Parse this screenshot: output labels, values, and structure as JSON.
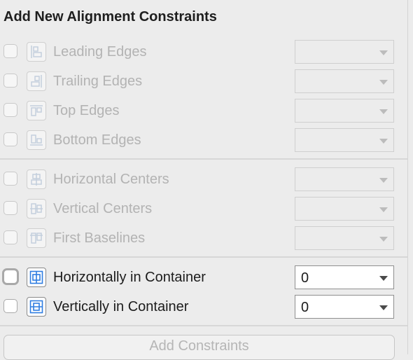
{
  "panel": {
    "title": "Add New Alignment Constraints"
  },
  "rows": [
    {
      "label": "Leading Edges",
      "icon": "leading-edges-icon",
      "enabled": false,
      "value": ""
    },
    {
      "label": "Trailing Edges",
      "icon": "trailing-edges-icon",
      "enabled": false,
      "value": ""
    },
    {
      "label": "Top Edges",
      "icon": "top-edges-icon",
      "enabled": false,
      "value": ""
    },
    {
      "label": "Bottom Edges",
      "icon": "bottom-edges-icon",
      "enabled": false,
      "value": ""
    },
    {
      "label": "Horizontal Centers",
      "icon": "horizontal-centers-icon",
      "enabled": false,
      "value": ""
    },
    {
      "label": "Vertical Centers",
      "icon": "vertical-centers-icon",
      "enabled": false,
      "value": ""
    },
    {
      "label": "First Baselines",
      "icon": "first-baselines-icon",
      "enabled": false,
      "value": ""
    },
    {
      "label": "Horizontally in Container",
      "icon": "horizontally-in-container-icon",
      "enabled": true,
      "value": "0"
    },
    {
      "label": "Vertically in Container",
      "icon": "vertically-in-container-icon",
      "enabled": true,
      "value": "0"
    }
  ],
  "add_button": {
    "label": "Add Constraints"
  },
  "colors": {
    "accent": "#2f7de1",
    "focus_ring": "#8cb4ee",
    "disabled_text": "#b3b3b3"
  }
}
